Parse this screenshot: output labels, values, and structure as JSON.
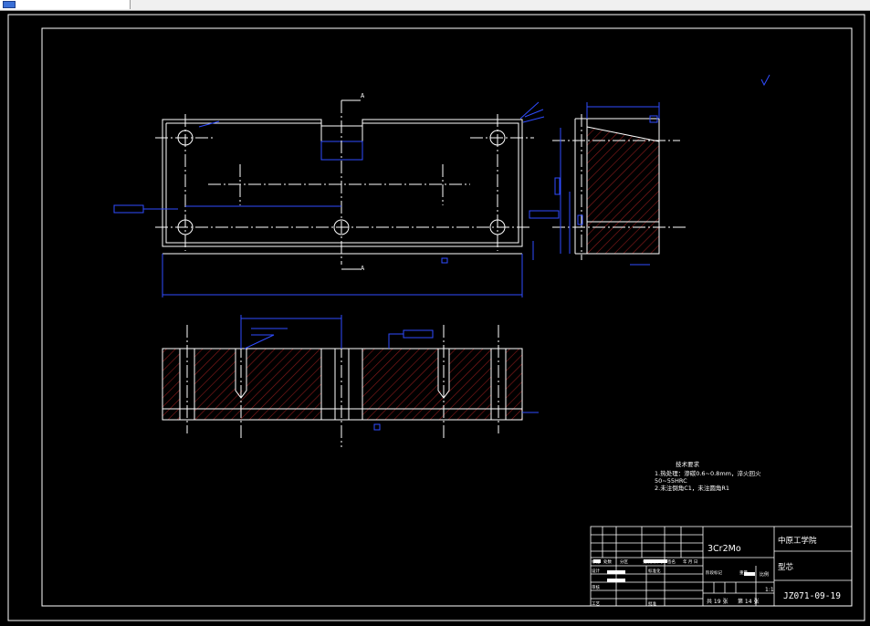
{
  "colors": {
    "background": "#000000",
    "line": "#ffffff",
    "dimension": "#0000ff",
    "hatch": "#8b1a1a",
    "text": "#ffffff"
  },
  "section_labels": {
    "cut": "A"
  },
  "technical_requirements": {
    "heading": "技术要求",
    "items": [
      "1.热处理：渗碳0.6~0.8mm，淬火回火",
      "50~55HRC",
      "2.未注倒角C1，未注圆角R1"
    ]
  },
  "title_block": {
    "material": "3Cr2Mo",
    "school": "中原工学院",
    "part_name": "型芯",
    "drawing_no": "JZ071-09-19",
    "scale_label": "比例",
    "scale_value": "1:1",
    "sheets_total": "共 19 张",
    "sheet_no": "第 14 张",
    "row_labels": [
      "标记",
      "处数",
      "分区",
      "更改文件号",
      "签名",
      "年 月 日"
    ],
    "designer": "设计",
    "standardization": "标准化",
    "stage_mark": "阶段标记",
    "weight": "重量",
    "review": "审核",
    "craft": "工艺",
    "approve": "批准"
  }
}
